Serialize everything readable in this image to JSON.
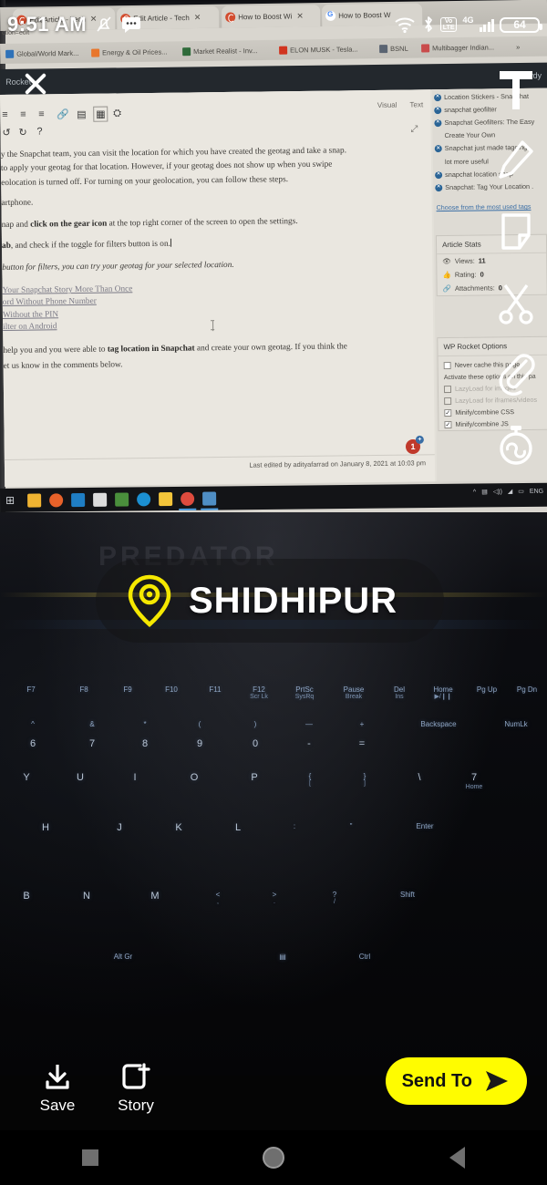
{
  "status_bar": {
    "time": "9:51 AM",
    "icons": [
      "notification-silenced-icon",
      "messages-icon",
      "wifi-icon",
      "bluetooth-icon"
    ],
    "volte_label_top": "Vo",
    "volte_label_bottom": "LTE",
    "network_type": "4G",
    "battery_level": "64"
  },
  "snapchat": {
    "close_label": "close",
    "tools": [
      {
        "name": "text-tool",
        "glyph": "T"
      },
      {
        "name": "draw-tool",
        "glyph": "pencil"
      },
      {
        "name": "sticker-tool",
        "glyph": "sticker"
      },
      {
        "name": "scissors-tool",
        "glyph": "scissors"
      },
      {
        "name": "attachment-tool",
        "glyph": "paperclip"
      },
      {
        "name": "timer-tool",
        "glyph": "stopwatch"
      }
    ],
    "geotag": {
      "text": "SHIDHIPUR",
      "pin_color": "#F5E800"
    },
    "actions": [
      {
        "name": "save",
        "label": "Save",
        "icon": "download-icon"
      },
      {
        "name": "story",
        "label": "Story",
        "icon": "add-to-story-icon"
      }
    ],
    "send_to": {
      "label": "Send To",
      "color": "#FFFC00",
      "icon": "send-arrow-icon"
    }
  },
  "nav_bar": {
    "recents": "recents-square-icon",
    "home": "home-circle-icon",
    "back": "back-triangle-icon"
  },
  "photo": {
    "laptop_brand": "PREDATOR"
  },
  "browser": {
    "url_fragment": "ction=edit",
    "tabs": [
      {
        "title": "Edit Article - Tech",
        "favicon": "wordpress-icon"
      },
      {
        "title": "Edit Article - Tech",
        "favicon": "wordpress-icon"
      },
      {
        "title": "How to Boost Wi",
        "favicon": "wordpress-icon"
      },
      {
        "title": "How to Boost W",
        "favicon": "google-icon"
      }
    ],
    "bookmarks": [
      {
        "label": "Global/World Mark...",
        "color": "#2f72b8"
      },
      {
        "label": "Energy & Oil Prices...",
        "color": "#e8762c"
      },
      {
        "label": "Market Realist - Inv...",
        "color": "#2f6b3a"
      },
      {
        "label": "ELON MUSK - Tesla...",
        "color": "#d1341f"
      },
      {
        "label": "BSNL",
        "color": "#5a6472"
      },
      {
        "label": "Multibagger Indian...",
        "color": "#c94b4b"
      }
    ],
    "overflow_label": "»"
  },
  "wordpress": {
    "admin_bar": {
      "left_label": "Rocket",
      "right_label": "Howdy"
    },
    "editor": {
      "visual_tab": "Visual",
      "text_tab": "Text",
      "paragraphs": [
        "y the Snapchat team, you can visit the location for which you have created the geotag and take a snap.",
        "to apply your geotag for that location. However, if your geotag does not show up when you swipe",
        "eolocation is turned off. For turning on your geolocation, you can follow these steps.",
        "artphone."
      ],
      "step_line_1_pre": "nap and ",
      "step_line_1_bold": "click on the gear icon",
      "step_line_1_post": " at the top right corner of the screen to open the settings.",
      "step_line_2_bold": "ab",
      "step_line_2_post": ", and check if the toggle for filters button is on.",
      "step_line_3": "button for filters, you can try your geotag for your selected location.",
      "links": [
        "Your Snapchat Story More Than Once",
        "ord Without Phone Number",
        "Without the PIN",
        "ilter on Android"
      ],
      "closing_pre": "help you and you were able to ",
      "closing_bold": "tag location in Snapchat",
      "closing_post": " and create your own geotag. If you think the",
      "closing_line2": "et us know in the comments below.",
      "last_edited": "Last edited by adityafarrad on January 8, 2021 at 10:03 pm",
      "comment_badge": "1"
    },
    "tag_suggestions": [
      "Location Stickers - Snapchat",
      "snapchat geofilter",
      "Snapchat Geofilters: The Easy",
      "Create Your Own",
      "Snapchat just made tagging",
      "lot more useful",
      "snapchat location snap",
      "Snapchat: Tag Your Location ."
    ],
    "choose_tags_link": "Choose from the most used tags",
    "article_stats": {
      "title": "Article Stats",
      "rows": [
        {
          "icon": "eye-icon",
          "label": "Views:",
          "value": "11"
        },
        {
          "icon": "thumbs-up-icon",
          "label": "Rating:",
          "value": "0"
        },
        {
          "icon": "link-icon",
          "label": "Attachments:",
          "value": "0"
        }
      ]
    },
    "wp_rocket": {
      "title": "WP Rocket Options",
      "never_cache_label": "Never cache this page",
      "activate_note": "Activate these options on this pa",
      "options": [
        {
          "label": "LazyLoad for images",
          "checked": false,
          "disabled": true
        },
        {
          "label": "LazyLoad for iframes/videos",
          "checked": false,
          "disabled": true
        },
        {
          "label": "Minify/combine CSS",
          "checked": true,
          "disabled": false
        },
        {
          "label": "Minify/combine JS",
          "checked": true,
          "disabled": false
        }
      ]
    }
  },
  "taskbar": {
    "items": [
      {
        "name": "file-explorer",
        "color": "#f0b432"
      },
      {
        "name": "firefox",
        "color": "#e8622a"
      },
      {
        "name": "mail",
        "color": "#1f7ec4"
      },
      {
        "name": "envelope",
        "color": "#dcdcdc"
      },
      {
        "name": "notes-app",
        "color": "#4a8f3c"
      },
      {
        "name": "edge",
        "color": "#1b8fd1"
      },
      {
        "name": "sticky-notes",
        "color": "#f2c43a"
      },
      {
        "name": "chrome",
        "color": "#dd4b3e"
      },
      {
        "name": "reader-app",
        "color": "#4f8ec4"
      }
    ],
    "tray_language": "ENG"
  },
  "keyboard": {
    "fn_row": [
      {
        "top": "F7",
        "sub": ""
      },
      {
        "top": "F8",
        "sub": ""
      },
      {
        "top": "F9",
        "sub": ""
      },
      {
        "top": "F10",
        "sub": ""
      },
      {
        "top": "F11",
        "sub": ""
      },
      {
        "top": "F12",
        "sub": "Scr Lk"
      },
      {
        "top": "PrtSc",
        "sub": "SysRq"
      },
      {
        "top": "Pause",
        "sub": "Break"
      },
      {
        "top": "Del",
        "sub": "Ins"
      },
      {
        "top": "Home",
        "sub": "▶/❙❙"
      },
      {
        "top": "Pg Up",
        "sub": ""
      },
      {
        "top": "Pg Dn",
        "sub": ""
      }
    ],
    "num_row_sym": [
      "^",
      "&",
      "*",
      "(",
      ")",
      "—",
      "+"
    ],
    "num_row": [
      "6",
      "7",
      "8",
      "9",
      "0",
      "-",
      "="
    ],
    "backspace": "Backspace",
    "numlk": "NumLk",
    "row_q": [
      "Y",
      "U",
      "I",
      "O",
      "P",
      "{",
      "}",
      "\\"
    ],
    "row_q_extra": [
      "[",
      "]"
    ],
    "numpad_7": "7",
    "numpad_7_sub": "Home",
    "row_a": [
      "H",
      "J",
      "K",
      "L",
      ":",
      "\""
    ],
    "enter": "Enter",
    "row_z": [
      "B",
      "N",
      "M",
      "<",
      ">",
      "?"
    ],
    "row_z_sub": [
      ",",
      ".",
      "/"
    ],
    "shift": "Shift",
    "bottom_row": [
      "Alt Gr",
      "Ctrl"
    ],
    "menu_key": "menu-icon"
  }
}
